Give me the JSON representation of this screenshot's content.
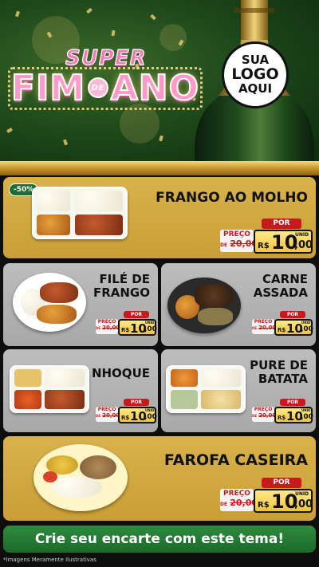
{
  "header": {
    "title_super": "SUPER",
    "title_fim": "FIM",
    "title_de": "DE",
    "title_ano": "ANO",
    "logo_line1": "SUA",
    "logo_line2": "LOGO",
    "logo_line3": "AQUI"
  },
  "products": [
    {
      "name": "FRANGO AO MOLHO",
      "badge": "-50%",
      "por": "POR",
      "preco": "PREÇO",
      "de": "DE",
      "old_price": "20,00",
      "currency": "R$",
      "price_int": "10",
      "price_dec": ",00",
      "unit": "UNID"
    },
    {
      "name_line1": "FILÉ DE",
      "name_line2": "FRANGO",
      "por": "POR",
      "preco": "PREÇO",
      "de": "DE",
      "old_price": "20,00",
      "currency": "R$",
      "price_int": "10",
      "price_dec": ",00",
      "unit": "UNID"
    },
    {
      "name_line1": "CARNE",
      "name_line2": "ASSADA",
      "por": "POR",
      "preco": "PREÇO",
      "de": "DE",
      "old_price": "20,00",
      "currency": "R$",
      "price_int": "10",
      "price_dec": ",00",
      "unit": "UNID"
    },
    {
      "name": "NHOQUE",
      "por": "POR",
      "preco": "PREÇO",
      "de": "DE",
      "old_price": "20,00",
      "currency": "R$",
      "price_int": "10",
      "price_dec": ",00",
      "unit": "UNID"
    },
    {
      "name_line1": "PURE DE",
      "name_line2": "BATATA",
      "por": "POR",
      "preco": "PREÇO",
      "de": "DE",
      "old_price": "20,00",
      "currency": "R$",
      "price_int": "10",
      "price_dec": ",00",
      "unit": "UNID"
    },
    {
      "name": "FAROFA CASEIRA",
      "por": "POR",
      "preco": "PREÇO",
      "de": "DE",
      "old_price": "20,00",
      "currency": "R$",
      "price_int": "10",
      "price_dec": ",00",
      "unit": "UNID"
    }
  ],
  "cta": "Crie seu encarte com este tema!",
  "footnote": "*Imagens Meramente Ilustrativas",
  "colors": {
    "gold": "#d9b24c",
    "gray_card": "#b3b3b3",
    "red": "#c71a1a",
    "green": "#1f6d31",
    "price_box": "#f0c43c"
  }
}
